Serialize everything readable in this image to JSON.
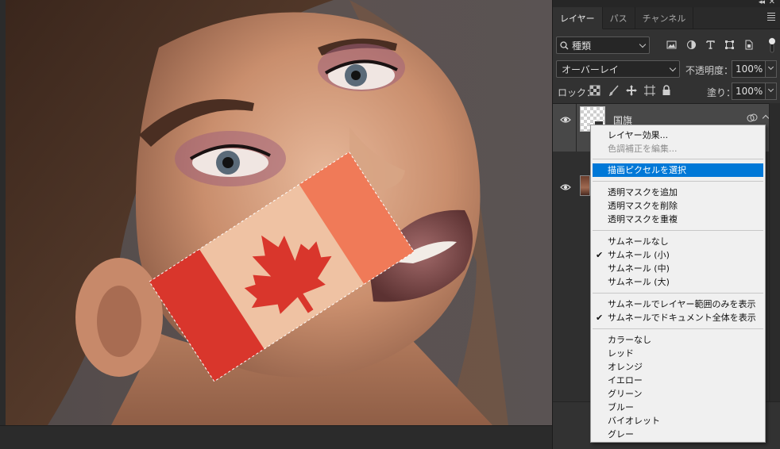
{
  "panel": {
    "tabs": [
      {
        "label": "レイヤー",
        "active": true
      },
      {
        "label": "パス",
        "active": false
      },
      {
        "label": "チャンネル",
        "active": false
      }
    ],
    "filter": {
      "label": "種類"
    },
    "blend_mode": "オーバーレイ",
    "opacity": {
      "label": "不透明度：",
      "value": "100%"
    },
    "lock": {
      "label": "ロック："
    },
    "fill": {
      "label": "塗り：",
      "value": "100%"
    },
    "layers": [
      {
        "name": "国旗",
        "visible": true,
        "selected": true
      },
      {
        "name": "",
        "visible": true,
        "selected": false
      }
    ]
  },
  "context_menu": {
    "highlight_color": "#0078d7",
    "items": [
      {
        "label": "レイヤー効果...",
        "enabled": true
      },
      {
        "label": "色調補正を編集...",
        "enabled": false
      },
      {
        "label": "描画ピクセルを選択",
        "enabled": true,
        "highlighted": true
      },
      {
        "label": "透明マスクを追加",
        "enabled": true
      },
      {
        "label": "透明マスクを削除",
        "enabled": true
      },
      {
        "label": "透明マスクを重複",
        "enabled": true
      },
      {
        "label": "サムネールなし",
        "enabled": true
      },
      {
        "label": "サムネール (小)",
        "enabled": true,
        "checked": true
      },
      {
        "label": "サムネール (中)",
        "enabled": true
      },
      {
        "label": "サムネール (大)",
        "enabled": true
      },
      {
        "label": "サムネールでレイヤー範囲のみを表示",
        "enabled": true
      },
      {
        "label": "サムネールでドキュメント全体を表示",
        "enabled": true,
        "checked": true
      },
      {
        "label": "カラーなし",
        "enabled": true
      },
      {
        "label": "レッド",
        "enabled": true
      },
      {
        "label": "オレンジ",
        "enabled": true
      },
      {
        "label": "イエロー",
        "enabled": true
      },
      {
        "label": "グリーン",
        "enabled": true
      },
      {
        "label": "ブルー",
        "enabled": true
      },
      {
        "label": "バイオレット",
        "enabled": true
      },
      {
        "label": "グレー",
        "enabled": true
      }
    ]
  }
}
